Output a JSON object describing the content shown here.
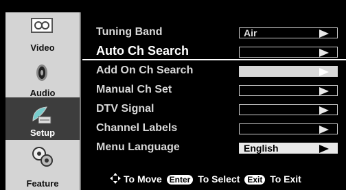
{
  "sidebar": {
    "items": [
      {
        "label": "Video",
        "icon": "video-icon",
        "active": false
      },
      {
        "label": "Audio",
        "icon": "speaker-icon",
        "active": false
      },
      {
        "label": "Setup",
        "icon": "satellite-dish-icon",
        "active": true
      },
      {
        "label": "Feature",
        "icon": "gears-icon",
        "active": false
      }
    ]
  },
  "menu": {
    "items": [
      {
        "label": "Tuning Band",
        "value": "Air"
      },
      {
        "label": "Auto Ch Search",
        "value": ""
      },
      {
        "label": "Add On Ch Search",
        "value": ""
      },
      {
        "label": "Manual Ch Set",
        "value": ""
      },
      {
        "label": "DTV Signal",
        "value": ""
      },
      {
        "label": "Channel Labels",
        "value": ""
      },
      {
        "label": "Menu Language",
        "value": "English"
      }
    ]
  },
  "footer": {
    "move_text": "To Move",
    "enter_key": "Enter",
    "select_text": "To Select",
    "exit_key": "Exit",
    "exit_text": "To Exit"
  }
}
